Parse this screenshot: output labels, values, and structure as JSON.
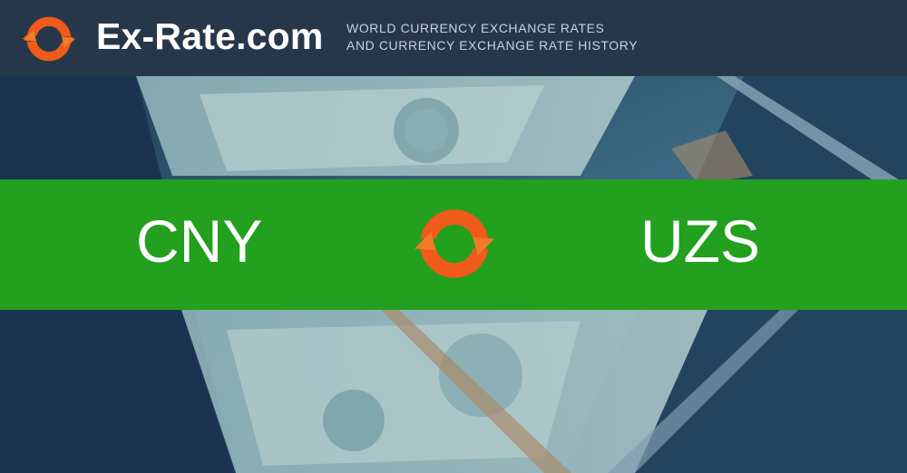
{
  "header": {
    "logo_icon": "rotating-arrows-icon",
    "site_name": "Ex-Rate.com",
    "tagline_line1": "WORLD CURRENCY EXCHANGE RATES",
    "tagline_line2": "AND CURRENCY EXCHANGE RATE HISTORY"
  },
  "banner": {
    "from_currency": "CNY",
    "to_currency": "UZS",
    "swap_icon": "rotating-arrows-icon"
  },
  "background": {
    "description_icon": "banknotes-in-case-image"
  },
  "colors": {
    "header_bg": "#27374a",
    "banner_green": "#22a01e",
    "accent_orange": "#f05a1a",
    "text_white": "#ffffff"
  }
}
